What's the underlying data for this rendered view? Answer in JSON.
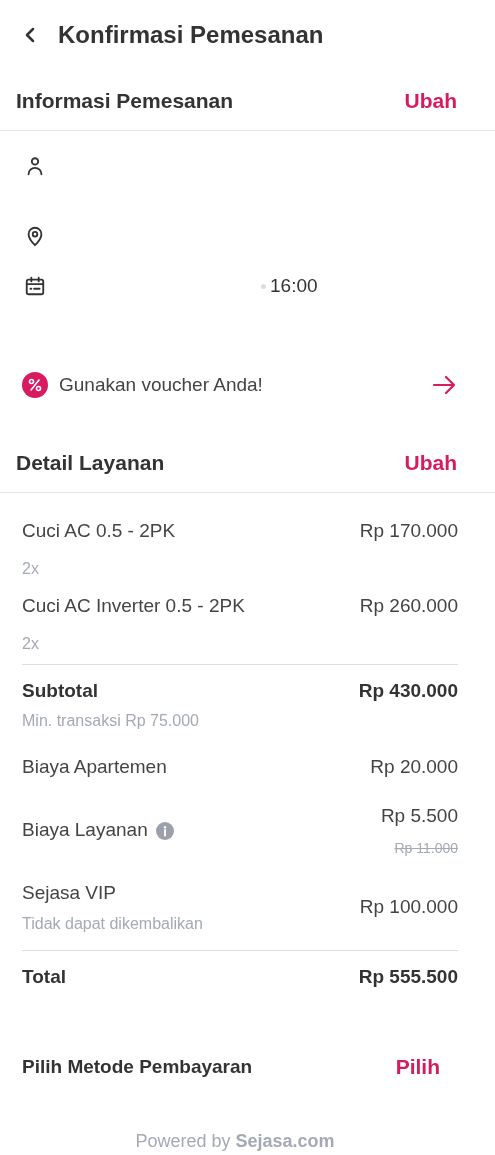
{
  "header": {
    "title": "Konfirmasi Pemesanan"
  },
  "booking_info": {
    "title": "Informasi Pemesanan",
    "action": "Ubah",
    "time": "16:00"
  },
  "voucher": {
    "label": "Gunakan voucher Anda!"
  },
  "service_detail": {
    "title": "Detail Layanan",
    "action": "Ubah",
    "items": [
      {
        "name": "Cuci AC 0.5 - 2PK",
        "qty": "2x",
        "price": "Rp 170.000"
      },
      {
        "name": "Cuci AC Inverter 0.5 - 2PK",
        "qty": "2x",
        "price": "Rp 260.000"
      }
    ]
  },
  "summary": [
    {
      "kind": "subtotal",
      "label": "Subtotal",
      "value": "Rp 430.000",
      "note": "Min. transaksi Rp 75.000",
      "info": false
    },
    {
      "kind": "fee",
      "label": "Biaya Apartemen",
      "value": "Rp 20.000",
      "info": false
    },
    {
      "kind": "fee",
      "label": "Biaya Layanan",
      "value": "Rp 5.500",
      "old_value": "Rp 11.000",
      "info": true
    },
    {
      "kind": "fee",
      "label": "Sejasa VIP",
      "value": "Rp 100.000",
      "note": "Tidak dapat dikembalikan",
      "info": false
    }
  ],
  "total": {
    "label": "Total",
    "value": "Rp 555.500"
  },
  "payment": {
    "label": "Pilih Metode Pembayaran",
    "action": "Pilih"
  },
  "footer": "Powered by **Sejasa.com**"
}
